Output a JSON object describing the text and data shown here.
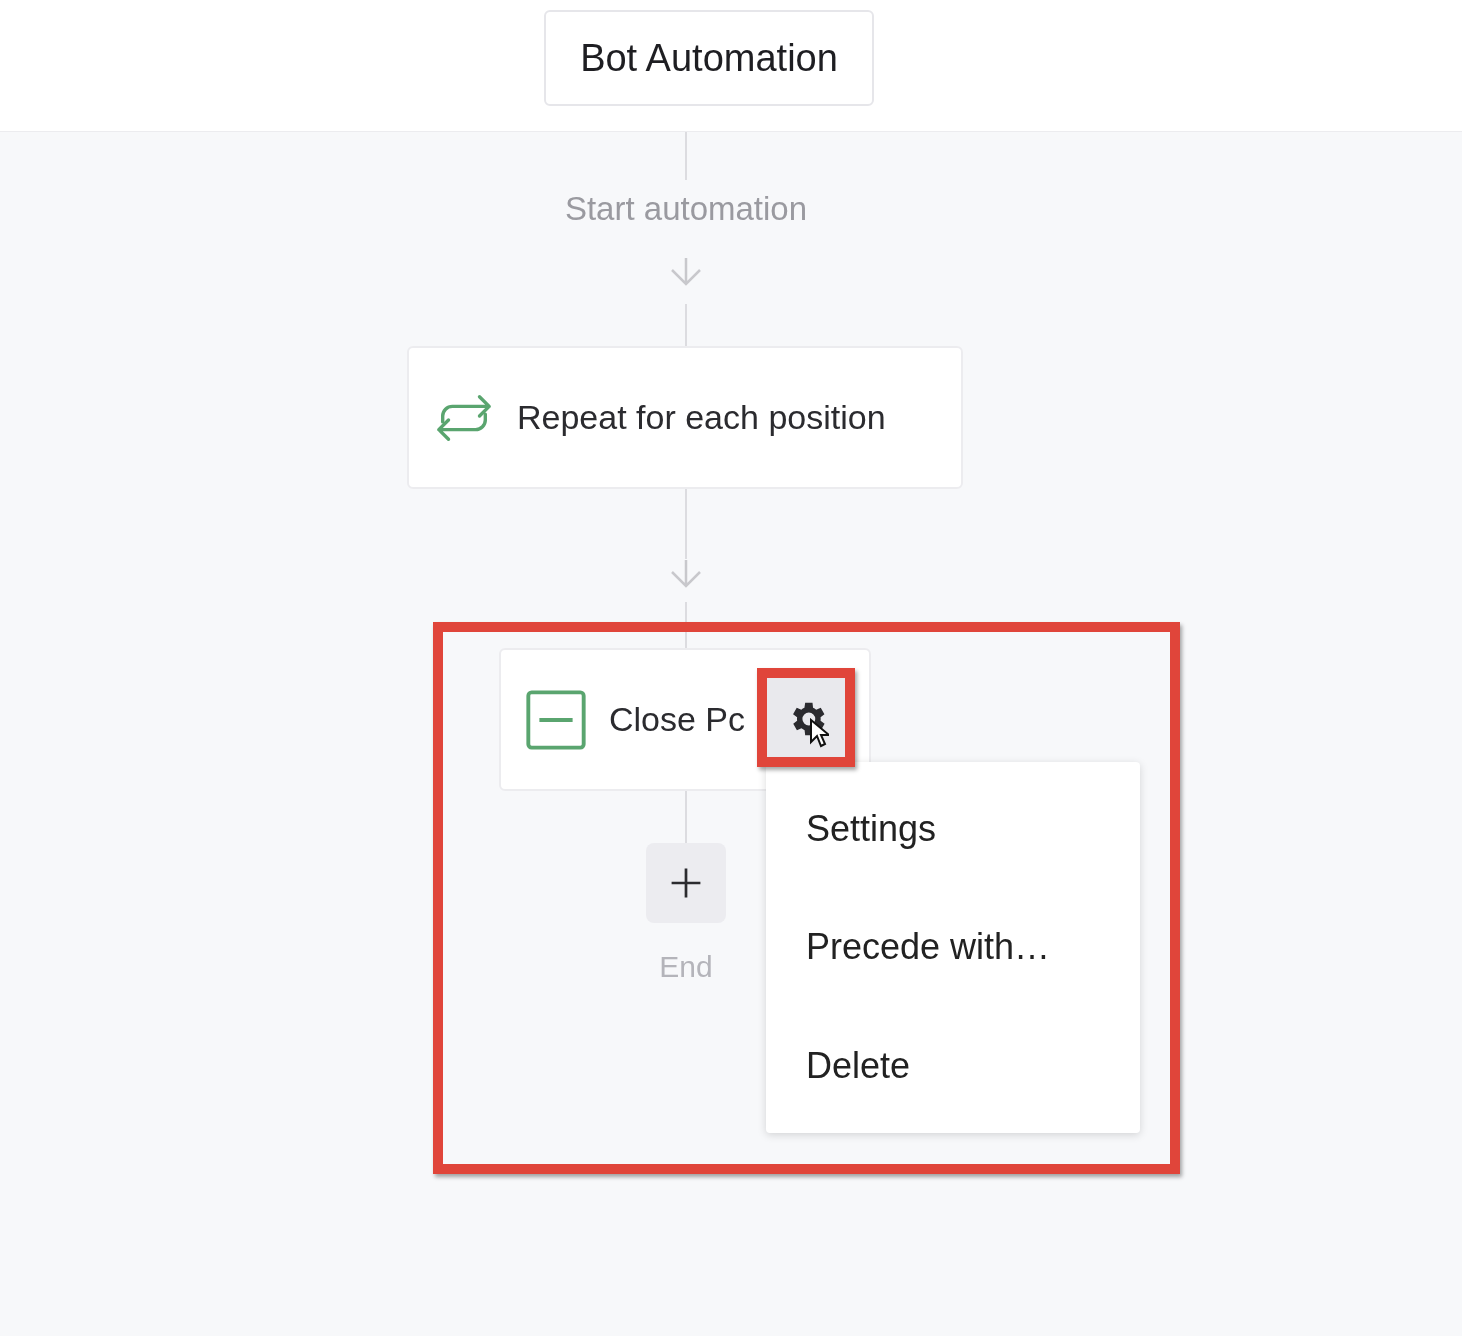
{
  "header": {
    "title": "Bot Automation"
  },
  "flow": {
    "start_label": "Start automation",
    "steps": [
      {
        "kind": "loop",
        "label": "Repeat for each position",
        "menu_open": false
      },
      {
        "kind": "action",
        "label": "Close Pc",
        "menu_open": true
      }
    ],
    "end_label": "End"
  },
  "context_menu": {
    "items": [
      "Settings",
      "Precede with…",
      "Delete"
    ]
  }
}
